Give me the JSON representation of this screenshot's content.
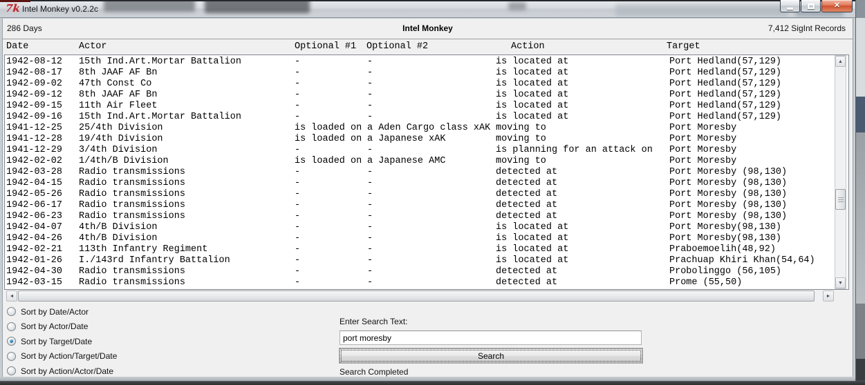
{
  "window": {
    "title": "Intel Monkey v0.2.2c"
  },
  "icons": {
    "app": "7k",
    "close": "✕",
    "scroll_up": "▲",
    "scroll_down": "▼",
    "scroll_left": "◄",
    "scroll_right": "►"
  },
  "header": {
    "days": "286 Days",
    "title": "Intel Monkey",
    "records": "7,412 SigInt Records"
  },
  "table": {
    "columns": [
      "Date",
      "Actor",
      "Optional #1",
      "Optional #2",
      "Action",
      "Target"
    ],
    "rows": [
      [
        "1942-08-12",
        "15th Ind.Art.Mortar Battalion",
        "-",
        "-",
        "is located at",
        "Port Hedland(57,129)"
      ],
      [
        "1942-08-17",
        "8th JAAF AF Bn",
        "-",
        "-",
        "is located at",
        "Port Hedland(57,129)"
      ],
      [
        "1942-09-02",
        "47th Const Co",
        "-",
        "-",
        "is located at",
        "Port Hedland(57,129)"
      ],
      [
        "1942-09-12",
        "8th JAAF AF Bn",
        "-",
        "-",
        "is located at",
        "Port Hedland(57,129)"
      ],
      [
        "1942-09-15",
        "11th Air Fleet",
        "-",
        "-",
        "is located at",
        "Port Hedland(57,129)"
      ],
      [
        "1942-09-16",
        "15th Ind.Art.Mortar Battalion",
        "-",
        "-",
        "is located at",
        "Port Hedland(57,129)"
      ],
      [
        "1941-12-25",
        "25/4th Division",
        "is loaded on",
        "a Aden Cargo class xAK",
        "moving to",
        "Port Moresby"
      ],
      [
        "1941-12-28",
        "19/4th Division",
        "is loaded on",
        "a Japanese xAK",
        "moving to",
        "Port Moresby"
      ],
      [
        "1941-12-29",
        "3/4th Division",
        "-",
        "-",
        "is planning for an attack on",
        "Port Moresby"
      ],
      [
        "1942-02-02",
        "1/4th/B Division",
        "is loaded on",
        "a Japanese AMC",
        "moving to",
        "Port Moresby"
      ],
      [
        "1942-03-28",
        "Radio transmissions",
        "-",
        "-",
        "detected at",
        "Port Moresby (98,130)"
      ],
      [
        "1942-04-15",
        "Radio transmissions",
        "-",
        "-",
        "detected at",
        "Port Moresby (98,130)"
      ],
      [
        "1942-05-26",
        "Radio transmissions",
        "-",
        "-",
        "detected at",
        "Port Moresby (98,130)"
      ],
      [
        "1942-06-17",
        "Radio transmissions",
        "-",
        "-",
        "detected at",
        "Port Moresby (98,130)"
      ],
      [
        "1942-06-23",
        "Radio transmissions",
        "-",
        "-",
        "detected at",
        "Port Moresby (98,130)"
      ],
      [
        "1942-04-07",
        "4th/B Division",
        "-",
        "-",
        "is located at",
        "Port Moresby(98,130)"
      ],
      [
        "1942-04-26",
        "4th/B Division",
        "-",
        "-",
        "is located at",
        "Port Moresby(98,130)"
      ],
      [
        "1942-02-21",
        "113th Infantry Regiment",
        "-",
        "-",
        "is located at",
        "Praboemoelih(48,92)"
      ],
      [
        "1942-01-26",
        "I./143rd Infantry Battalion",
        "-",
        "-",
        "is located at",
        "Prachuap Khiri Khan(54,64)"
      ],
      [
        "1942-04-30",
        "Radio transmissions",
        "-",
        "-",
        "detected at",
        "Probolinggo (56,105)"
      ],
      [
        "1942-03-15",
        "Radio transmissions",
        "-",
        "-",
        "detected at",
        "Prome (55,50)"
      ]
    ]
  },
  "sort": {
    "options": [
      {
        "label": "Sort by Date/Actor",
        "selected": false
      },
      {
        "label": "Sort by Actor/Date",
        "selected": false
      },
      {
        "label": "Sort by Target/Date",
        "selected": true
      },
      {
        "label": "Sort by Action/Target/Date",
        "selected": false
      },
      {
        "label": "Sort by Action/Actor/Date",
        "selected": false
      }
    ]
  },
  "search": {
    "label": "Enter Search Text:",
    "value": "port moresby",
    "button": "Search",
    "status": "Search Completed"
  },
  "colors": {
    "close_button": "#d0563f",
    "radio_selected_dot": "#2d7db3",
    "titlebar": "#d7dbdf",
    "client_background": "#f0f0f0"
  }
}
